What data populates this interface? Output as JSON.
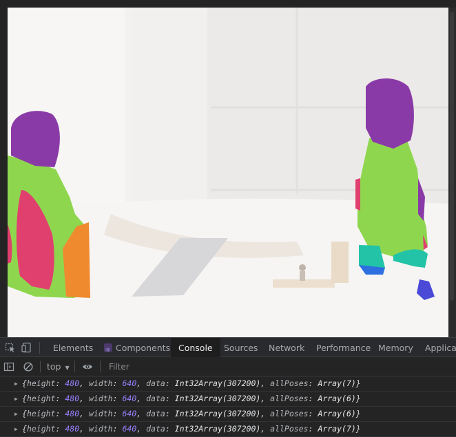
{
  "devtools": {
    "tabs": [
      {
        "label": "Elements",
        "active": false
      },
      {
        "label": "Components",
        "active": false
      },
      {
        "label": "Console",
        "active": true
      },
      {
        "label": "Sources",
        "active": false
      },
      {
        "label": "Network",
        "active": false
      },
      {
        "label": "Performance",
        "active": false
      },
      {
        "label": "Memory",
        "active": false
      },
      {
        "label": "Applicat",
        "active": false
      }
    ],
    "icons": {
      "inspect": "inspect-element-icon",
      "device": "device-toolbar-icon",
      "sidebar": "show-sidebar-icon",
      "clear": "clear-console-icon",
      "live": "live-expression-eye-icon",
      "dropdown": "dropdown-arrow-icon",
      "expand": "expand-arrow-icon"
    }
  },
  "console": {
    "context": "top",
    "filter_placeholder": "Filter",
    "logs": [
      {
        "height": "480",
        "width": "640",
        "data": "Int32Array(307200)",
        "allPoses": "Array(7)"
      },
      {
        "height": "480",
        "width": "640",
        "data": "Int32Array(307200)",
        "allPoses": "Array(6)"
      },
      {
        "height": "480",
        "width": "640",
        "data": "Int32Array(307200)",
        "allPoses": "Array(6)"
      },
      {
        "height": "480",
        "width": "640",
        "data": "Int32Array(307200)",
        "allPoses": "Array(7)"
      }
    ]
  },
  "colors": {
    "segment_purple": "#8a3aa6",
    "segment_green": "#8fd64f",
    "segment_pink": "#e0406e",
    "segment_orange": "#f08a2e",
    "segment_blue": "#2e6fe0",
    "segment_cyan": "#22c3a6",
    "number": "#9980ff"
  }
}
